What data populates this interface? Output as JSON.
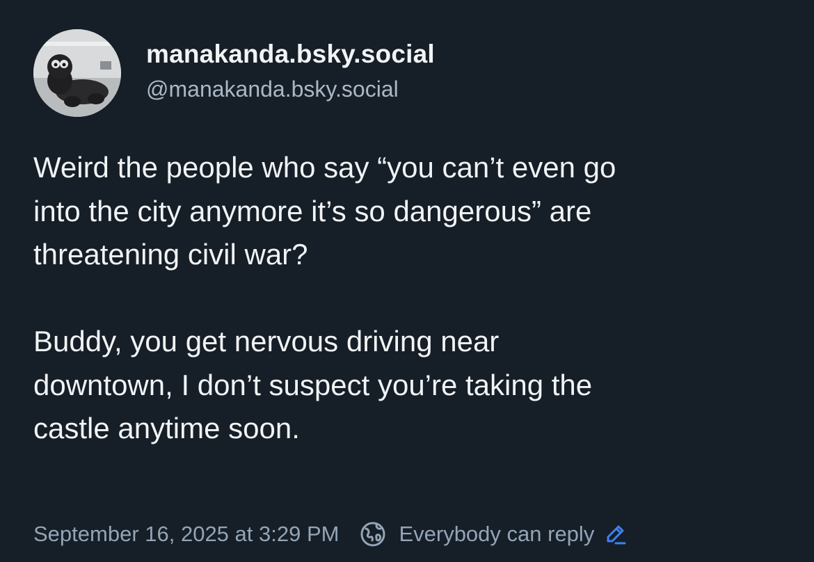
{
  "author": {
    "display_name": "manakanda.bsky.social",
    "handle": "@manakanda.bsky.social",
    "avatar_icon": "avatar-photo"
  },
  "post": {
    "text": "Weird the people who say “you can’t even go\ninto the city anymore it’s so dangerous” are\nthreatening civil war?\n\nBuddy, you get nervous driving near\ndowntown, I don’t suspect you’re taking the\ncastle anytime soon."
  },
  "footer": {
    "timestamp": "September 16, 2025 at 3:29 PM",
    "reply_setting": "Everybody can reply",
    "globe_icon": "globe-icon",
    "edit_icon": "pencil-icon",
    "accent_color": "#3b82f6"
  },
  "colors": {
    "background": "#161e27",
    "text": "#f1f3f5",
    "muted": "#93a5b7"
  }
}
